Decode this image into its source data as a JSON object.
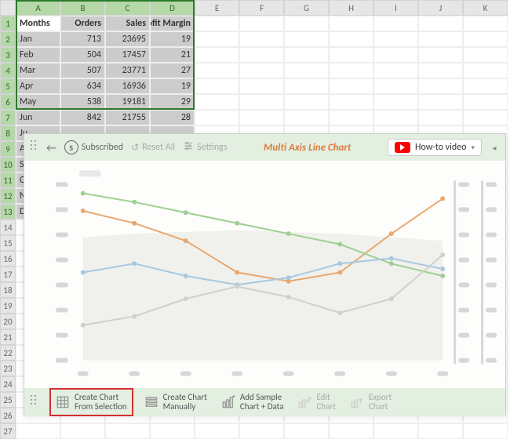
{
  "columns": [
    "A",
    "B",
    "C",
    "D",
    "E",
    "F",
    "G",
    "H",
    "I",
    "J",
    "K"
  ],
  "rows_visible": 27,
  "selected_cols": [
    0,
    1,
    2,
    3
  ],
  "selected_rows": [
    1,
    2,
    3,
    4,
    5,
    6,
    7,
    8,
    9,
    10,
    11,
    12,
    13
  ],
  "headers": [
    "Months",
    "Orders",
    "Sales",
    "Profit Margin"
  ],
  "data": [
    [
      "Jan",
      "713",
      "23695",
      "19"
    ],
    [
      "Feb",
      "504",
      "17457",
      "21"
    ],
    [
      "Mar",
      "507",
      "23771",
      "27"
    ],
    [
      "Apr",
      "634",
      "16936",
      "19"
    ],
    [
      "May",
      "538",
      "19181",
      "29"
    ],
    [
      "Jun",
      "842",
      "21755",
      "28"
    ],
    [
      "Ju",
      null,
      null,
      null
    ],
    [
      "A",
      null,
      null,
      null
    ],
    [
      "S",
      null,
      null,
      null
    ],
    [
      "O",
      null,
      null,
      null
    ],
    [
      "N",
      null,
      null,
      null
    ],
    [
      "D",
      null,
      null,
      null
    ]
  ],
  "panel": {
    "subscribed": "Subscribed",
    "reset": "Reset All",
    "settings": "Settings",
    "title": "Multi Axis Line Chart",
    "howto": "How-to video"
  },
  "toolbar": {
    "create_sel_l1": "Create Chart",
    "create_sel_l2": "From Selection",
    "create_man_l1": "Create Chart",
    "create_man_l2": "Manually",
    "add_sample_l1": "Add Sample",
    "add_sample_l2": "Chart + Data",
    "edit_l1": "Edit",
    "edit_l2": "Chart",
    "export_l1": "Export",
    "export_l2": "Chart"
  },
  "chart_data": {
    "type": "line",
    "x": [
      1,
      2,
      3,
      4,
      5,
      6,
      7
    ],
    "series": [
      {
        "name": "orange",
        "color": "#e8a870",
        "y": [
          85,
          78,
          68,
          50,
          45,
          50,
          72,
          92
        ]
      },
      {
        "name": "green",
        "color": "#9fcf93",
        "y": [
          95,
          90,
          84,
          78,
          72,
          66,
          55,
          48
        ]
      },
      {
        "name": "blue",
        "color": "#a8c8e0",
        "y": [
          50,
          55,
          48,
          43,
          47,
          55,
          58,
          52
        ]
      },
      {
        "name": "gray",
        "color": "#cfcfcf",
        "y": [
          20,
          25,
          35,
          42,
          36,
          27,
          35,
          60
        ]
      },
      {
        "name": "area",
        "color": "#eceee9",
        "y": [
          70,
          72,
          73,
          74,
          73,
          72,
          70,
          68
        ]
      }
    ],
    "left_axis_ticks": 8,
    "right_axis_groups": 2
  }
}
